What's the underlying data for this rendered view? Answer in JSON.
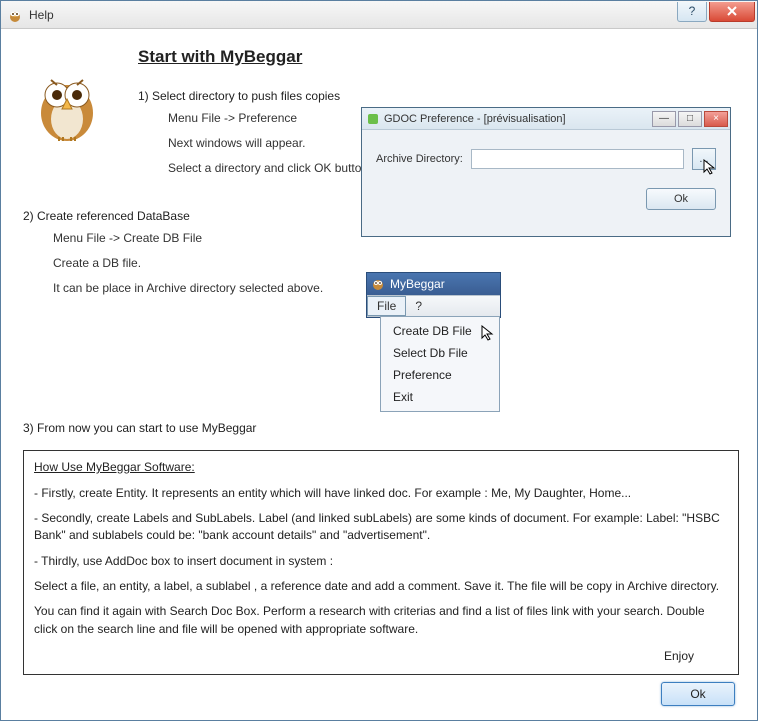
{
  "window": {
    "title": "Help"
  },
  "heading": "Start with MyBeggar",
  "step1": {
    "title": "1) Select directory to push files copies",
    "lines": [
      "Menu File -> Preference",
      "Next windows will appear.",
      "Select a directory and click OK button"
    ]
  },
  "pref": {
    "title": "GDOC Preference - [prévisualisation]",
    "label": "Archive Directory:",
    "browse": "...",
    "ok": "Ok"
  },
  "step2": {
    "title": "2) Create referenced DataBase",
    "lines": [
      "Menu File -> Create DB File",
      "Create a DB file.",
      " It can be place in Archive directory selected above."
    ]
  },
  "app": {
    "title": "MyBeggar",
    "menu": {
      "file": "File",
      "help": "?"
    },
    "dropdown": [
      "Create DB File",
      "Select Db File",
      "Preference",
      "Exit"
    ]
  },
  "step3": {
    "title": "3) From now you can start to use MyBeggar"
  },
  "howuse": {
    "title": "How Use MyBeggar Software:",
    "p1": "- Firstly, create Entity. It represents an entity which will have linked doc. For example : Me, My Daughter, Home...",
    "p2": "- Secondly, create Labels and SubLabels. Label (and linked subLabels) are some kinds of document. For example: Label: \"HSBC Bank\" and sublabels could be: \"bank account details\" and \"advertisement\".",
    "p3": "- Thirdly, use AddDoc box to insert document in system :",
    "p4": "Select a file, an entity, a label, a sublabel , a reference date and add a comment. Save it. The file will be copy in Archive directory.",
    "p5": "You can find it again with Search Doc Box. Perform a research with criterias and find a list of files link with your search. Double click on the search line and file will be opened with appropriate software.",
    "enjoy": "Enjoy"
  },
  "ok": "Ok"
}
